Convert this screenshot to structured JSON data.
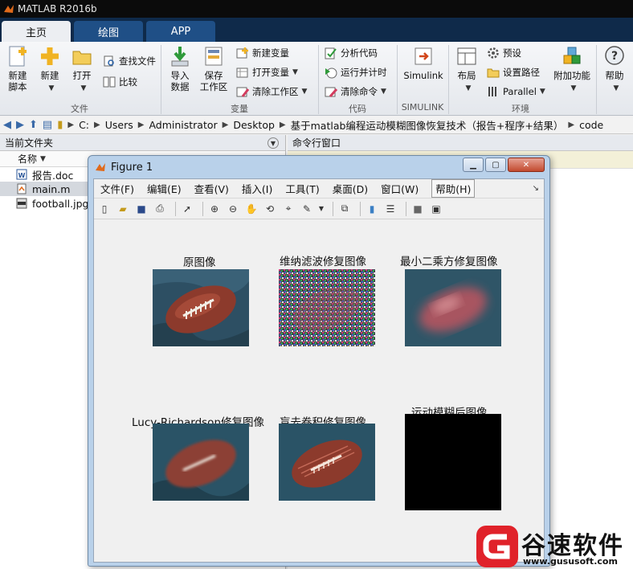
{
  "app": {
    "title": "MATLAB R2016b"
  },
  "tabs": [
    {
      "label": "主页",
      "active": true
    },
    {
      "label": "绘图",
      "active": false
    },
    {
      "label": "APP",
      "active": false
    }
  ],
  "ribbon": {
    "new_script": [
      "新建",
      "脚本"
    ],
    "new": "新建",
    "open": "打开",
    "find_files": "查找文件",
    "compare": "比较",
    "group_file": "文件",
    "import": [
      "导入",
      "数据"
    ],
    "save": [
      "保存",
      "工作区"
    ],
    "new_variable": "新建变量",
    "open_variable": "打开变量",
    "clear_workspace": "清除工作区",
    "group_variable": "变量",
    "analyze_code": "分析代码",
    "run_time": "运行并计时",
    "clear_commands": "清除命令",
    "group_code": "代码",
    "simulink": "Simulink",
    "group_simulink": "SIMULINK",
    "layout": "布局",
    "preferences": "预设",
    "set_path": "设置路径",
    "parallel": "Parallel",
    "group_env": "环境",
    "addons": "附加功能",
    "help": "帮助"
  },
  "address": [
    "C:",
    "Users",
    "Administrator",
    "Desktop",
    "基于matlab编程运动模糊图像恢复技术（报告+程序+结果）",
    "code"
  ],
  "current_folder": {
    "title": "当前文件夹",
    "column": "名称",
    "files": [
      {
        "name": "报告.doc",
        "icon": "word-doc-icon",
        "selected": false
      },
      {
        "name": "main.m",
        "icon": "matlab-script-icon",
        "selected": true
      },
      {
        "name": "football.jpg",
        "icon": "jpg-image-icon",
        "selected": false
      }
    ]
  },
  "command_window": {
    "title": "命令行窗口"
  },
  "figure": {
    "title": "Figure 1",
    "menu": [
      "文件(F)",
      "编辑(E)",
      "查看(V)",
      "插入(I)",
      "工具(T)",
      "桌面(D)",
      "窗口(W)",
      "帮助(H)"
    ],
    "subplots": [
      {
        "title": "原图像",
        "kind": "original"
      },
      {
        "title": "维纳滤波修复图像",
        "kind": "noisy"
      },
      {
        "title": "最小二乘方修复图像",
        "kind": "blurred"
      },
      {
        "title": "Lucy-Richardson修复图像",
        "kind": "lucy"
      },
      {
        "title": "盲去卷积修复图像",
        "kind": "blind"
      },
      {
        "title": "运动模糊后图像",
        "kind": "black"
      }
    ]
  },
  "watermark": {
    "brand": "谷速软件",
    "url": "www.gususoft.com"
  },
  "colors": {
    "tab_bar": "#0f2a4a",
    "tab_inactive": "#1f4f86",
    "figure_frame": "#b9d1ea",
    "logo_red": "#e0222a"
  }
}
